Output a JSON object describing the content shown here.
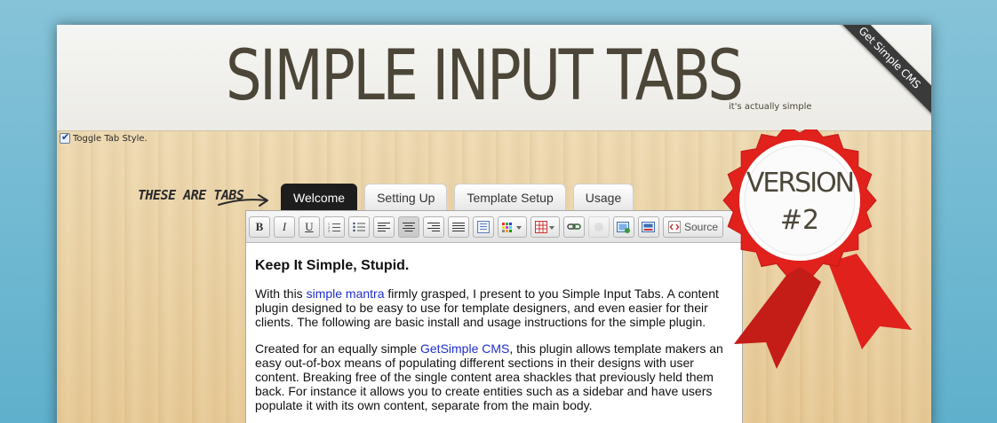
{
  "header": {
    "title": "SIMPLE INPUT TABS",
    "tagline": "it's actually simple",
    "corner_ribbon": "Get Simple CMS"
  },
  "toggle": {
    "label": "Toggle Tab Style.",
    "checked": true
  },
  "annotation": {
    "label": "THESE ARE TABS"
  },
  "tabs": [
    {
      "label": "Welcome",
      "active": true
    },
    {
      "label": "Setting Up",
      "active": false
    },
    {
      "label": "Template Setup",
      "active": false
    },
    {
      "label": "Usage",
      "active": false
    }
  ],
  "toolbar": {
    "bold": "B",
    "italic": "I",
    "underline": "U",
    "source_label": "Source"
  },
  "content": {
    "heading": "Keep It Simple, Stupid.",
    "p1_pre": "With this ",
    "p1_link": "simple mantra",
    "p1_post": " firmly grasped, I present to you Simple Input Tabs. A content plugin designed to be easy to use for template designers, and even easier for their clients. The following are basic install and usage instructions for the simple plugin.",
    "p2_pre": "Created for an equally simple ",
    "p2_link": "GetSimple CMS",
    "p2_post": ", this plugin allows template makers an easy out-of-box means of populating different sections in their designs with user content. Breaking free of the single content area shackles that previously held them back. For instance it allows you to create entities such as a sidebar and have users populate it with its own content, separate from the main body."
  },
  "badge": {
    "line1": "VERSION",
    "line2": "#2"
  },
  "colors": {
    "seal_red": "#e0211c",
    "tab_active": "#1d1d1d",
    "link": "#1f2fcc",
    "title": "#4b4638"
  }
}
